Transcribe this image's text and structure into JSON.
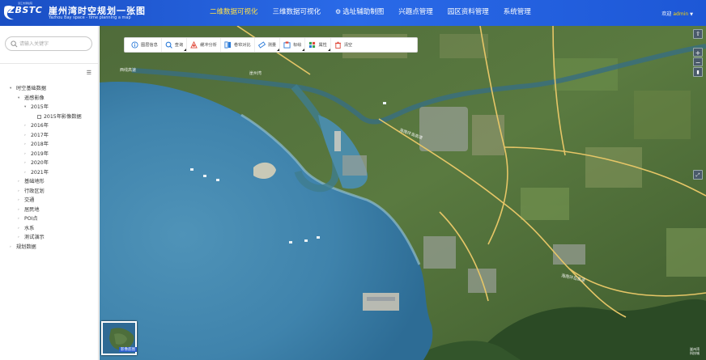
{
  "header": {
    "logo_text": "ZBSTC",
    "logo_sub": "湛江市测绘院",
    "title": "崖州湾时空规划一张图",
    "subtitle": "Yazhou Bay space - time planning a map",
    "nav": [
      {
        "label": "二维数据可视化",
        "active": true
      },
      {
        "label": "三维数据可视化",
        "active": false
      },
      {
        "label": "选址辅助制图",
        "active": false,
        "icon": "gear-icon"
      },
      {
        "label": "兴趣点管理",
        "active": false
      },
      {
        "label": "园区资料管理",
        "active": false
      },
      {
        "label": "系统管理",
        "active": false
      }
    ],
    "welcome": "欢迎",
    "user": "admin"
  },
  "sidebar": {
    "search_placeholder": "请输入关键字",
    "collapse_icon": "list-icon",
    "tree": [
      {
        "label": "时空基础数据",
        "level": 0,
        "arrow": "▾",
        "checkbox": false
      },
      {
        "label": "遥感影像",
        "level": 1,
        "arrow": "▾",
        "checkbox": false
      },
      {
        "label": "2015年",
        "level": 2,
        "arrow": "▾",
        "checkbox": false
      },
      {
        "label": "2015年影像数据",
        "level": 3,
        "arrow": "",
        "checkbox": true
      },
      {
        "label": "2016年",
        "level": 2,
        "arrow": "›",
        "checkbox": false
      },
      {
        "label": "2017年",
        "level": 2,
        "arrow": "›",
        "checkbox": false
      },
      {
        "label": "2018年",
        "level": 2,
        "arrow": "›",
        "checkbox": false
      },
      {
        "label": "2019年",
        "level": 2,
        "arrow": "›",
        "checkbox": false
      },
      {
        "label": "2020年",
        "level": 2,
        "arrow": "›",
        "checkbox": false
      },
      {
        "label": "2021年",
        "level": 2,
        "arrow": "›",
        "checkbox": false
      },
      {
        "label": "基础地形",
        "level": 1,
        "arrow": "›",
        "checkbox": false
      },
      {
        "label": "行政区划",
        "level": 1,
        "arrow": "›",
        "checkbox": false
      },
      {
        "label": "交通",
        "level": 1,
        "arrow": "›",
        "checkbox": false
      },
      {
        "label": "居民地",
        "level": 1,
        "arrow": "›",
        "checkbox": false
      },
      {
        "label": "POI点",
        "level": 1,
        "arrow": "›",
        "checkbox": false
      },
      {
        "label": "水系",
        "level": 1,
        "arrow": "›",
        "checkbox": false
      },
      {
        "label": "测试演示",
        "level": 1,
        "arrow": "›",
        "checkbox": false
      },
      {
        "label": "规划数据",
        "level": 0,
        "arrow": "›",
        "checkbox": false
      }
    ]
  },
  "toolbar": {
    "tools": [
      {
        "label": "图层信息",
        "icon": "info-icon",
        "color": "#2a7ad8",
        "dropdown": false
      },
      {
        "label": "查询",
        "icon": "search-icon",
        "color": "#2a7ad8",
        "dropdown": true
      },
      {
        "label": "缓冲分析",
        "icon": "buffer-icon",
        "color": "#e04a3a",
        "dropdown": false
      },
      {
        "label": "卷帘对比",
        "icon": "compare-icon",
        "color": "#2a7ad8",
        "dropdown": false
      },
      {
        "label": "测量",
        "icon": "ruler-icon",
        "color": "#2a7ad8",
        "dropdown": true
      },
      {
        "label": "标绘",
        "icon": "plot-icon",
        "color": "#e04a3a",
        "dropdown": true
      },
      {
        "label": "属性",
        "icon": "attribute-icon",
        "color": "#3aa050",
        "dropdown": true
      },
      {
        "label": "清空",
        "icon": "clear-icon",
        "color": "#e04a3a",
        "dropdown": false
      }
    ]
  },
  "map": {
    "minimap_label": "影像底图",
    "corner_text_1": "崖州湾",
    "corner_text_2": "科技城",
    "zoom_in": "+",
    "zoom_out": "−"
  }
}
